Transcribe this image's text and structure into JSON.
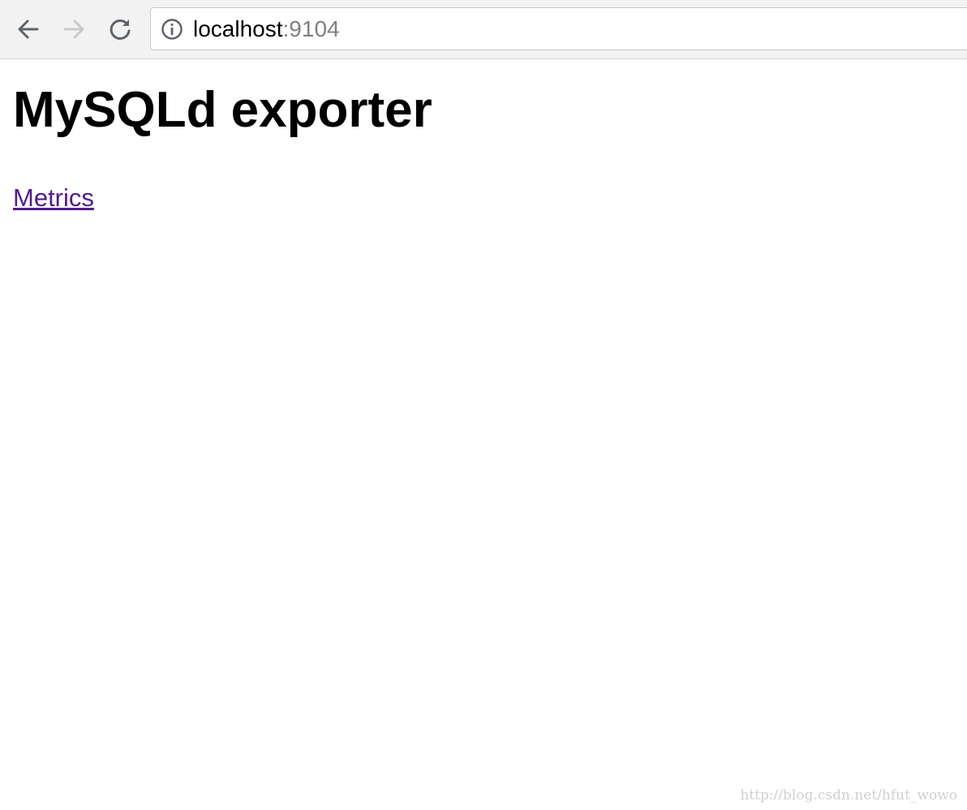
{
  "browser": {
    "address_bar": {
      "host": "localhost",
      "port": ":9104"
    },
    "icons": {
      "back": "back-arrow-icon",
      "forward": "forward-arrow-icon",
      "reload": "reload-icon",
      "site_info": "info-icon"
    }
  },
  "page": {
    "heading": "MySQLd exporter",
    "link_label": "Metrics"
  },
  "watermark": "http://blog.csdn.net/hfut_wowo",
  "colors": {
    "link_visited": "#551a8b",
    "port_text": "#808080",
    "toolbar_bg": "#f2f2f2"
  }
}
